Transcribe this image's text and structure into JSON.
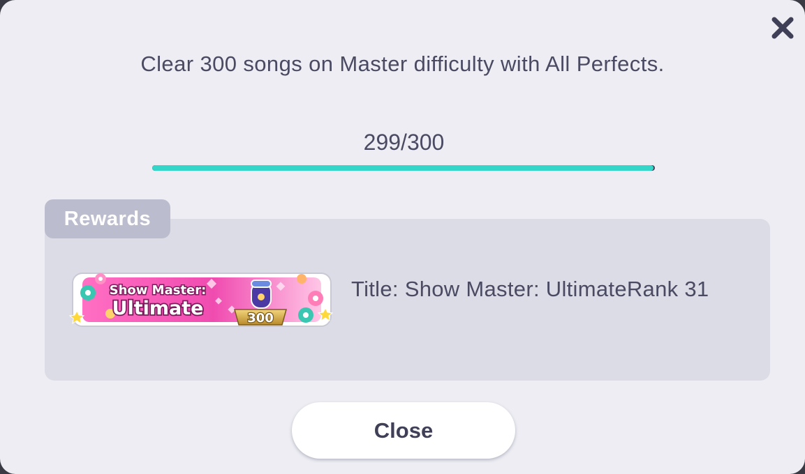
{
  "dialog": {
    "mission": "Clear 300 songs on Master difficulty with All Perfects.",
    "progress": {
      "text": "299/300",
      "current": 299,
      "total": 300,
      "fill_percent": 99.67
    },
    "close_icon": "close-x-icon"
  },
  "rewards": {
    "tab_label": "Rewards",
    "badge": {
      "line1": "Show Master:",
      "line2": "Ultimate",
      "number": "300",
      "icon": "microphone-trophy-badge"
    },
    "item_text": "Title: Show Master: UltimateRank 31"
  },
  "footer": {
    "close_label": "Close"
  },
  "colors": {
    "dialog_bg": "#ededf3",
    "text": "#4a4a63",
    "progress_fill": "#33d6c8",
    "tab_bg": "#bcbccf",
    "panel_bg": "#dcdce6"
  }
}
